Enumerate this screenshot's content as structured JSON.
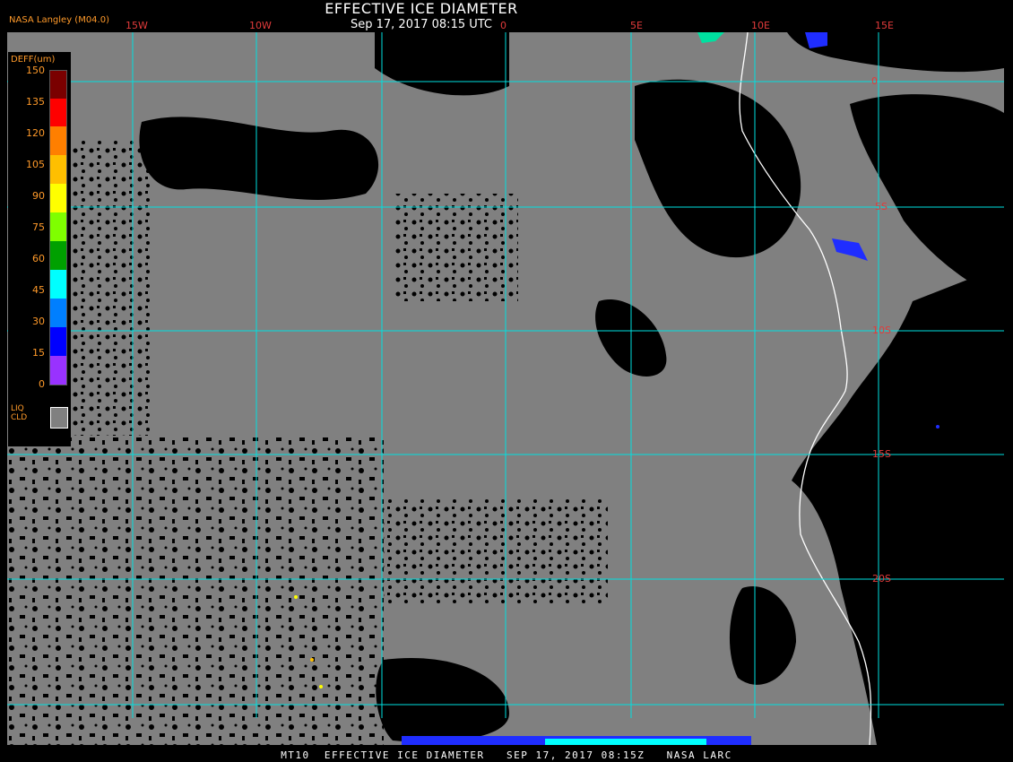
{
  "title": "EFFECTIVE ICE DIAMETER",
  "timestamp": "Sep 17, 2017 08:15 UTC",
  "producer": "NASA Langley (M04.0)",
  "footer": "MT10  EFFECTIVE ICE DIAMETER   SEP 17, 2017 08:15Z   NASA LARC",
  "longitude_labels": [
    "15W",
    "10W",
    "0",
    "5E",
    "10E",
    "15E"
  ],
  "latitude_labels": [
    "0",
    "5S",
    "10S",
    "15S",
    "20S"
  ],
  "legend": {
    "title": "DEFF(um)",
    "ticks": [
      "150",
      "135",
      "120",
      "105",
      "90",
      "75",
      "60",
      "45",
      "30",
      "15",
      "0"
    ],
    "colors": [
      "#7a0000",
      "#ff0000",
      "#ff7f00",
      "#ffbf00",
      "#ffff00",
      "#7fff00",
      "#00a000",
      "#00ffff",
      "#007fff",
      "#0000ff",
      "#9932ff"
    ],
    "liquid_label_line1": "LIQ",
    "liquid_label_line2": "CLD",
    "liquid_color": "#808080"
  },
  "colors": {
    "background": "#000000",
    "cloud_gray": "#808080",
    "grid": "#00e0e0",
    "coastline": "#ffffff",
    "label_red": "#e23b3b",
    "label_orange": "#ff9a2a"
  }
}
